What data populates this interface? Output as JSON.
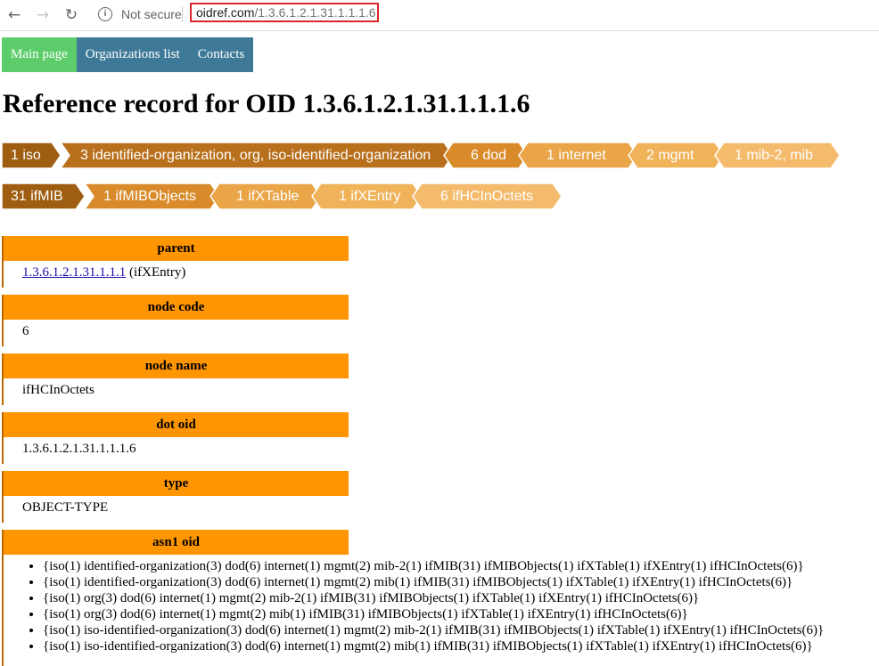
{
  "browser": {
    "back_icon": "back-arrow-icon",
    "forward_icon": "forward-arrow-icon",
    "reload_icon": "reload-icon",
    "info_icon": "info-icon",
    "security_label": "Not secure",
    "url_host": "oidref.com",
    "url_path": "/1.3.6.1.2.1.31.1.1.1.6"
  },
  "menu": {
    "items": [
      {
        "label": "Main page"
      },
      {
        "label": "Organizations list"
      },
      {
        "label": "Contacts"
      }
    ]
  },
  "title": "Reference record for OID 1.3.6.1.2.1.31.1.1.1.6",
  "breadcrumbs": {
    "row1": [
      {
        "label": "1 iso",
        "color": "#9e5d10"
      },
      {
        "label": "3 identified-organization, org, iso-identified-organization",
        "color": "#b8701c"
      },
      {
        "label": "6 dod",
        "color": "#d98b2b"
      },
      {
        "label": "1 internet",
        "color": "#e9a547"
      },
      {
        "label": "2 mgmt",
        "color": "#f0b35a"
      },
      {
        "label": "1 mib-2, mib",
        "color": "#f5bb6c"
      }
    ],
    "row2": [
      {
        "label": "31 ifMIB",
        "color": "#9e5d10"
      },
      {
        "label": "1 ifMIBObjects",
        "color": "#d98b2b"
      },
      {
        "label": "1 ifXTable",
        "color": "#e9a547"
      },
      {
        "label": "1 ifXEntry",
        "color": "#f0b35a"
      },
      {
        "label": "6 ifHCInOctets",
        "color": "#f5bb6c"
      }
    ]
  },
  "sections": {
    "parent": {
      "heading": "parent",
      "link": "1.3.6.1.2.1.31.1.1.1",
      "suffix": " (ifXEntry)"
    },
    "node_code": {
      "heading": "node code",
      "value": "6"
    },
    "node_name": {
      "heading": "node name",
      "value": "ifHCInOctets"
    },
    "dot_oid": {
      "heading": "dot oid",
      "value": "1.3.6.1.2.1.31.1.1.1.6"
    },
    "type": {
      "heading": "type",
      "value": "OBJECT-TYPE"
    },
    "asn1_oid": {
      "heading": "asn1 oid",
      "items": [
        "{iso(1) identified-organization(3) dod(6) internet(1) mgmt(2) mib-2(1) ifMIB(31) ifMIBObjects(1) ifXTable(1) ifXEntry(1) ifHCInOctets(6)}",
        "{iso(1) identified-organization(3) dod(6) internet(1) mgmt(2) mib(1) ifMIB(31) ifMIBObjects(1) ifXTable(1) ifXEntry(1) ifHCInOctets(6)}",
        "{iso(1) org(3) dod(6) internet(1) mgmt(2) mib-2(1) ifMIB(31) ifMIBObjects(1) ifXTable(1) ifXEntry(1) ifHCInOctets(6)}",
        "{iso(1) org(3) dod(6) internet(1) mgmt(2) mib(1) ifMIB(31) ifMIBObjects(1) ifXTable(1) ifXEntry(1) ifHCInOctets(6)}",
        "{iso(1) iso-identified-organization(3) dod(6) internet(1) mgmt(2) mib-2(1) ifMIB(31) ifMIBObjects(1) ifXTable(1) ifXEntry(1) ifHCInOctets(6)}",
        "{iso(1) iso-identified-organization(3) dod(6) internet(1) mgmt(2) mib(1) ifMIB(31) ifMIBObjects(1) ifXTable(1) ifXEntry(1) ifHCInOctets(6)}"
      ]
    }
  }
}
